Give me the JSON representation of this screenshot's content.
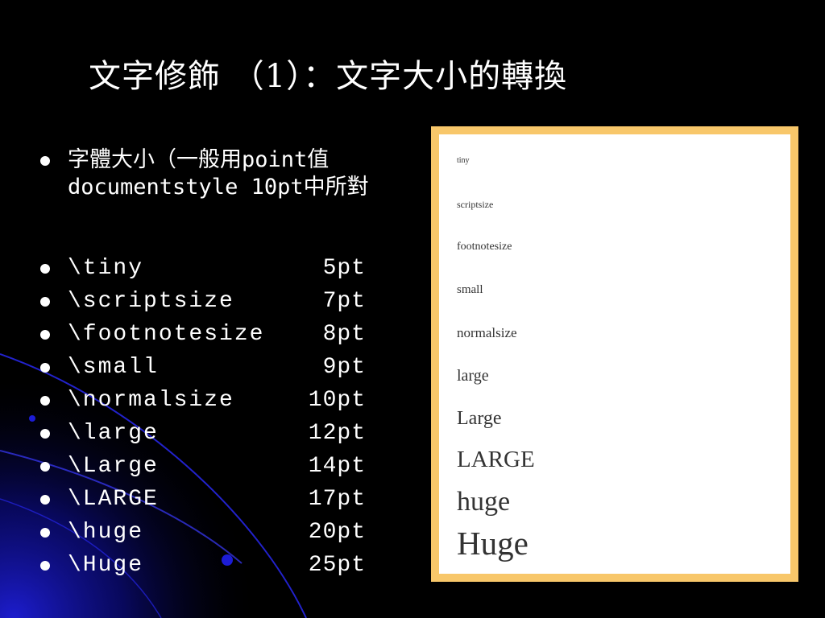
{
  "slide": {
    "title": "文字修飾 （1）：文字大小的轉換",
    "intro_line1": "字體大小（一般用point值",
    "intro_line2": "documentstyle 10pt中所對",
    "sizes": [
      {
        "command": "\\tiny",
        "size": "5pt"
      },
      {
        "command": "\\scriptsize",
        "size": "7pt"
      },
      {
        "command": "\\footnotesize",
        "size": "8pt"
      },
      {
        "command": "\\small",
        "size": "9pt"
      },
      {
        "command": "\\normalsize",
        "size": "10pt"
      },
      {
        "command": "\\large",
        "size": "12pt"
      },
      {
        "command": "\\Large",
        "size": "14pt"
      },
      {
        "command": "\\LARGE",
        "size": "17pt"
      },
      {
        "command": "\\huge",
        "size": "20pt"
      },
      {
        "command": "\\Huge",
        "size": "25pt"
      }
    ]
  },
  "sample_image": {
    "labels": [
      "tiny",
      "scriptsize",
      "footnotesize",
      "small",
      "normalsize",
      "large",
      "Large",
      "LARGE",
      "huge",
      "Huge"
    ],
    "border_color": "#f8c76a"
  },
  "colors": {
    "background": "#000000",
    "swoosh": "#1a1acc",
    "text": "#ffffff"
  }
}
